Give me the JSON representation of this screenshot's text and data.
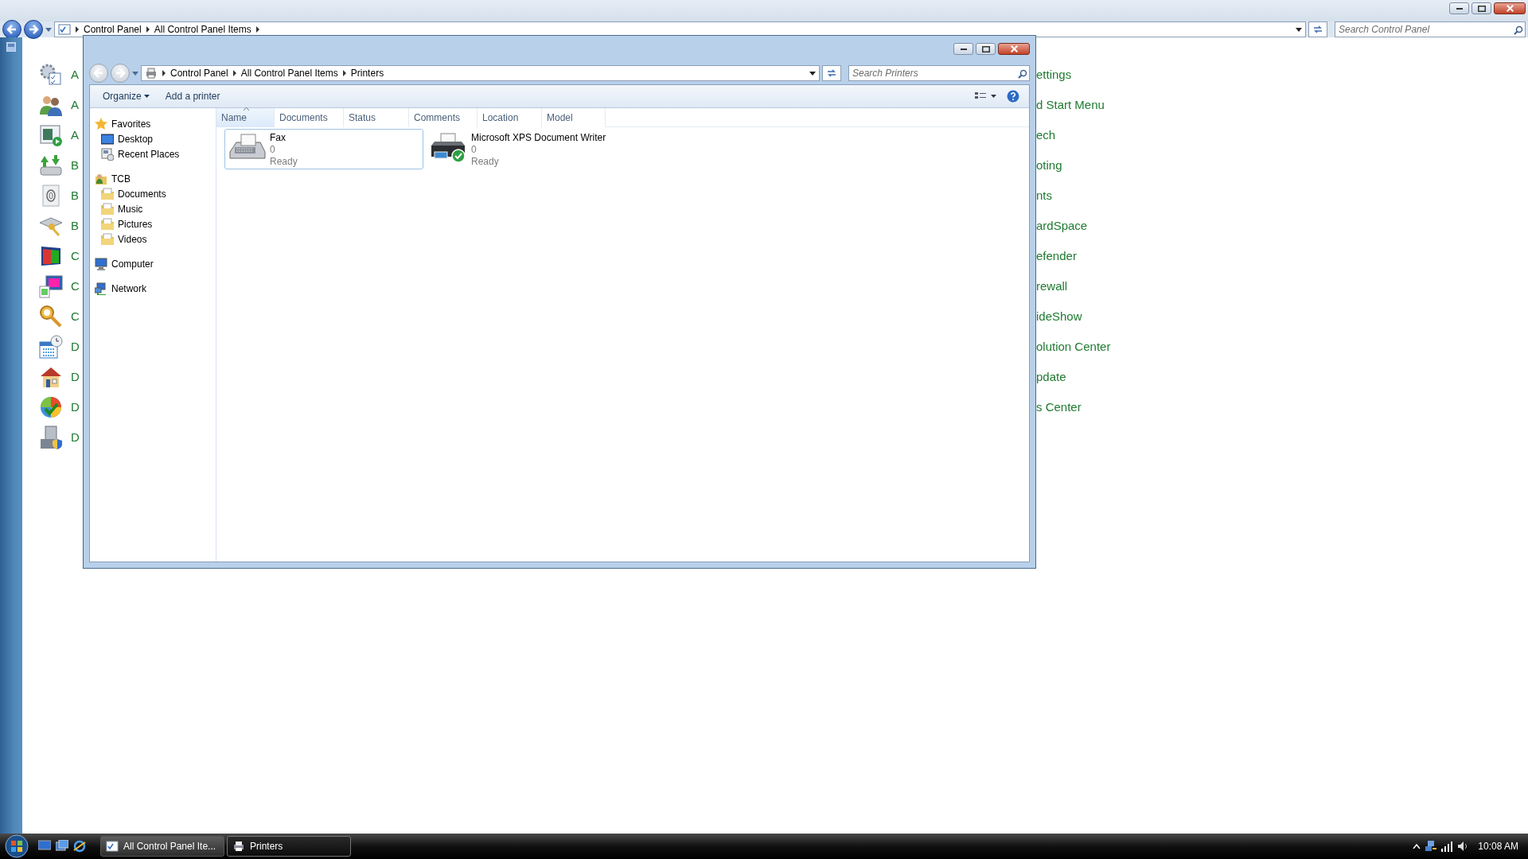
{
  "background_window": {
    "breadcrumb": [
      "Control Panel",
      "All Control Panel Items"
    ],
    "search": {
      "placeholder": "Search Control Panel"
    },
    "items_left": [
      "A",
      "A",
      "A",
      "B",
      "B",
      "B",
      "C",
      "C",
      "C",
      "D",
      "D",
      "D",
      "D"
    ],
    "items_right": [
      "ettings",
      "d Start Menu",
      "ech",
      "oting",
      "nts",
      "ardSpace",
      "efender",
      "rewall",
      "ideShow",
      "olution Center",
      "pdate",
      "s Center"
    ]
  },
  "window": {
    "breadcrumb": [
      "Control Panel",
      "All Control Panel Items",
      "Printers"
    ],
    "search": {
      "placeholder": "Search Printers"
    },
    "toolbar": [
      {
        "label": "Organize",
        "dropdown": true
      },
      {
        "label": "Add a printer",
        "dropdown": false
      }
    ],
    "nav": [
      {
        "label": "Favorites",
        "children": [
          "Desktop",
          "Recent Places"
        ]
      },
      {
        "label": "TCB",
        "children": [
          "Documents",
          "Music",
          "Pictures",
          "Videos"
        ]
      },
      {
        "label": "Computer"
      },
      {
        "label": "Network"
      }
    ],
    "columns": [
      {
        "label": "Name",
        "sorted": true
      },
      {
        "label": "Documents",
        "sorted": false
      },
      {
        "label": "Status",
        "sorted": false
      },
      {
        "label": "Comments",
        "sorted": false
      },
      {
        "label": "Location",
        "sorted": false
      },
      {
        "label": "Model",
        "sorted": false
      }
    ],
    "printers": [
      {
        "kind": "fax",
        "name": "Fax",
        "documents": "0",
        "status": "Ready",
        "selected": true,
        "default": false
      },
      {
        "kind": "printer",
        "name": "Microsoft XPS Document Writer",
        "documents": "0",
        "status": "Ready",
        "selected": false,
        "default": true
      }
    ]
  },
  "taskbar": {
    "tasks": [
      {
        "label": "All Control Panel Ite...",
        "selected": false
      },
      {
        "label": "Printers",
        "selected": true
      }
    ],
    "clock": "10:08 AM"
  }
}
